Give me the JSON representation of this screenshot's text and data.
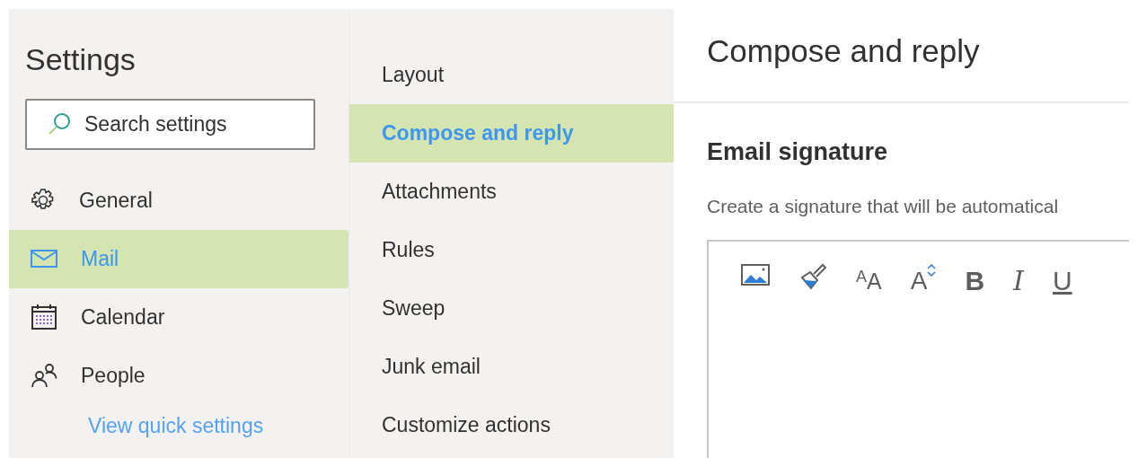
{
  "settings": {
    "title": "Settings",
    "search": {
      "placeholder": "Search settings"
    },
    "items": [
      {
        "label": "General",
        "kind": "gear",
        "selected": false
      },
      {
        "label": "Mail",
        "kind": "mail",
        "selected": true
      },
      {
        "label": "Calendar",
        "kind": "calendar",
        "selected": false
      },
      {
        "label": "People",
        "kind": "people",
        "selected": false
      }
    ],
    "link": "View quick settings"
  },
  "categories": [
    {
      "label": "Layout",
      "selected": false
    },
    {
      "label": "Compose and reply",
      "selected": true
    },
    {
      "label": "Attachments",
      "selected": false
    },
    {
      "label": "Rules",
      "selected": false
    },
    {
      "label": "Sweep",
      "selected": false
    },
    {
      "label": "Junk email",
      "selected": false
    },
    {
      "label": "Customize actions",
      "selected": false
    }
  ],
  "content": {
    "title": "Compose and reply",
    "section": "Email signature",
    "description": "Create a signature that will be automatical",
    "toolbar": [
      {
        "kind": "image"
      },
      {
        "kind": "paint"
      },
      {
        "kind": "font-size",
        "glyphs": [
          "A",
          "A"
        ]
      },
      {
        "kind": "grow",
        "glyph": "A"
      },
      {
        "kind": "bold",
        "glyph": "B"
      },
      {
        "kind": "italic",
        "glyph": "I"
      },
      {
        "kind": "underline",
        "glyph": "U"
      }
    ]
  }
}
